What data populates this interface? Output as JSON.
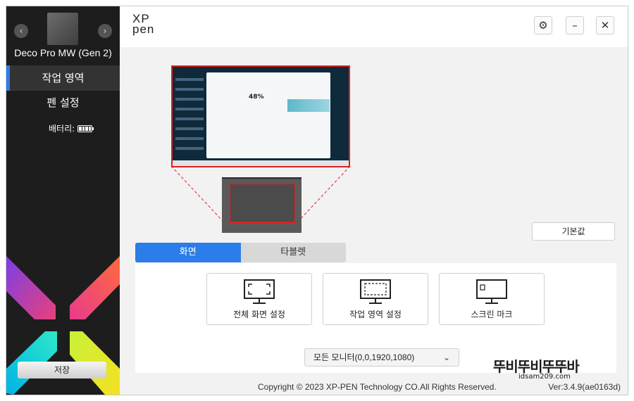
{
  "sidebar": {
    "device_name": "Deco Pro MW (Gen 2)",
    "menu": [
      {
        "label": "작업 영역",
        "active": true
      },
      {
        "label": "펜 설정",
        "active": false
      }
    ],
    "battery_label": "배터리:",
    "save_label": "저장",
    "accent_color": "#2b7de9"
  },
  "header": {
    "logo_line1": "XP",
    "logo_line2": "pen",
    "icons": [
      "gear-icon",
      "minimize-icon",
      "close-icon"
    ]
  },
  "preview": {
    "battery_percent": "48%"
  },
  "default_button": "기본값",
  "tabs": [
    {
      "label": "화면",
      "active": true
    },
    {
      "label": "타블렛",
      "active": false
    }
  ],
  "cards": [
    {
      "label": "전체 화면 설정"
    },
    {
      "label": "작업 영역 설정"
    },
    {
      "label": "스크린 마크"
    }
  ],
  "monitor_select": {
    "value": "모든 모니터(0,0,1920,1080)"
  },
  "footer": {
    "copyright": "Copyright © 2023  XP-PEN Technology CO.All Rights Reserved.",
    "version": "Ver:3.4.9(ae0163d)"
  },
  "watermark": {
    "text": "뚜비뚜비뚜뚜바",
    "url": "idsam209.com"
  }
}
